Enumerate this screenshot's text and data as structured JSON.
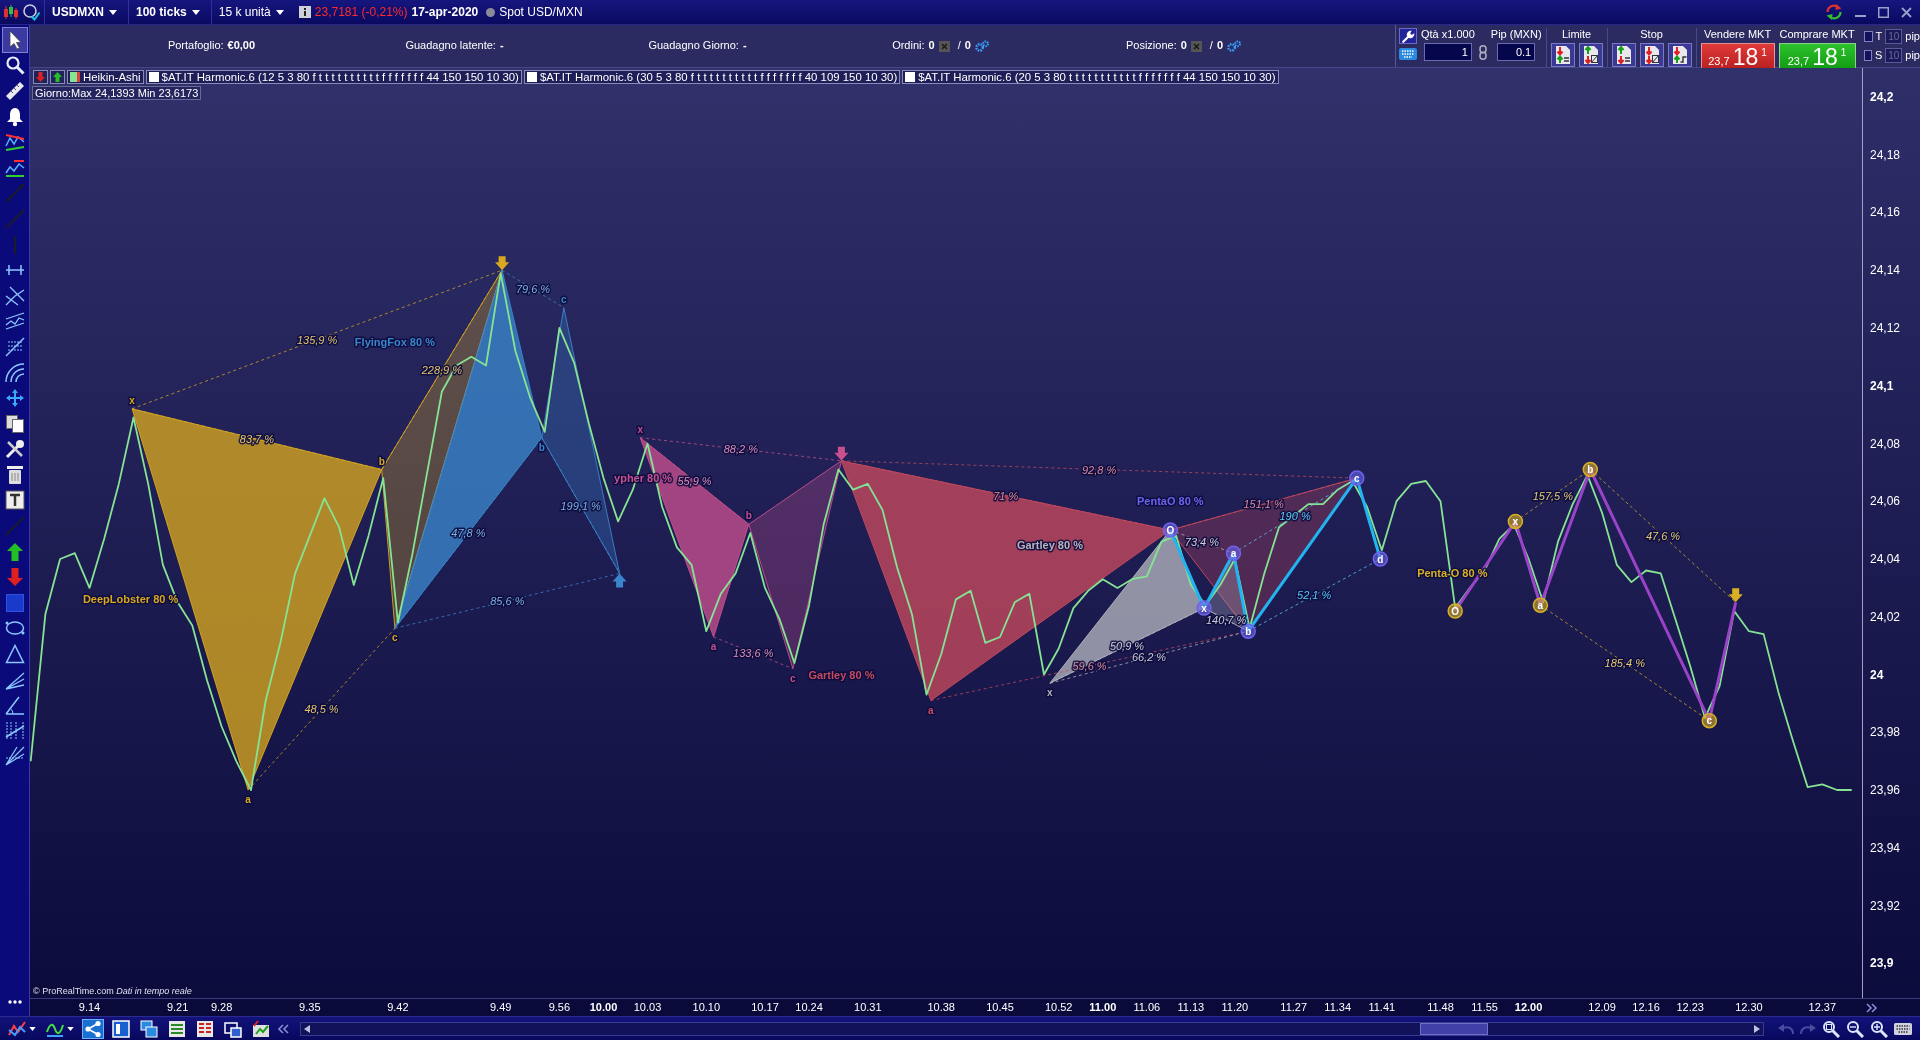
{
  "top_bar": {
    "instrument": "USDMXN",
    "interval": "100 ticks",
    "units": "15 k unità",
    "last_price": "23,7181 (-0,21%)",
    "date": "17-apr-2020",
    "market": "Spot USD/MXN"
  },
  "account": [
    {
      "label": "Portafoglio:",
      "value": "€0,00"
    },
    {
      "label": "Guadagno latente:",
      "value": "-"
    },
    {
      "label": "Guadagno Giorno:",
      "value": "-"
    }
  ],
  "counters": [
    {
      "label": "Ordini:",
      "value": "0",
      "divider": "/",
      "value_2": "0"
    },
    {
      "label": "Posizione:",
      "value": "0",
      "divider": "/",
      "value_2": "0"
    }
  ],
  "order_panel": {
    "quantity": {
      "label": "Qtà x1.000",
      "value": "1"
    },
    "pip": {
      "label": "Pip (MXN)",
      "value": "0.1"
    },
    "limit_label": "Limite",
    "stop_label": "Stop",
    "sell": {
      "label": "Vendere MKT",
      "prefix": "23,7",
      "big": "18",
      "pipette": "1"
    },
    "buy": {
      "label": "Comprare MKT",
      "prefix": "23,7",
      "big": "18",
      "pipette": "1"
    }
  },
  "trailing": [
    {
      "label": "T",
      "checked": false,
      "value": "10",
      "unit": "pip",
      "disabled": true
    },
    {
      "label": "S",
      "checked": false,
      "value": "10",
      "unit": "pip",
      "disabled": true
    }
  ],
  "tools": [
    {
      "kind": "cursor",
      "selected": true
    },
    {
      "kind": "zoom",
      "selected": false
    },
    {
      "kind": "ruler",
      "selected": false
    },
    {
      "kind": "alert",
      "selected": false
    },
    {
      "kind": "zigzag",
      "selected": false
    },
    {
      "kind": "wave",
      "selected": false
    },
    {
      "kind": "segment",
      "selected": false
    },
    {
      "kind": "line",
      "selected": false
    },
    {
      "kind": "vline",
      "selected": false
    },
    {
      "kind": "hline",
      "selected": false
    },
    {
      "kind": "pitchfork",
      "selected": false
    },
    {
      "kind": "channel",
      "selected": false
    },
    {
      "kind": "fibonacci",
      "selected": false
    },
    {
      "kind": "arcs",
      "selected": false
    },
    {
      "kind": "move",
      "selected": false
    },
    {
      "kind": "copy",
      "selected": false
    },
    {
      "kind": "tools",
      "selected": false
    },
    {
      "kind": "trash",
      "selected": false
    },
    {
      "kind": "text",
      "selected": false
    },
    {
      "kind": "ray",
      "selected": false
    },
    {
      "kind": "buy",
      "selected": false
    },
    {
      "kind": "sell",
      "selected": false
    },
    {
      "kind": "rectangle",
      "selected": false
    },
    {
      "kind": "ellipse",
      "selected": false
    },
    {
      "kind": "triangle",
      "selected": false
    },
    {
      "kind": "fan",
      "selected": false
    },
    {
      "kind": "angle",
      "selected": false
    },
    {
      "kind": "timezones",
      "selected": false
    },
    {
      "kind": "gann",
      "selected": false
    }
  ],
  "chart": {
    "legend": [
      {
        "label": "$AT.IT Harmonic.6 (12 5 3 80 f t t t t t t t t t t f f f f f f f 44 150 150 10 30)"
      },
      {
        "label": "$AT.IT Harmonic.6 (30 5 3 80 f t t t t t t t t t t f f f f f f f 40 109 150 10 30)"
      },
      {
        "label": "$AT.IT Harmonic.6 (20 5 3 80 t t t t t t t t t t t f f f f f f f 44 150 150 10 30)"
      }
    ],
    "day_range": "Giorno:Max 24,1393 Min 23,6173",
    "credit": "© ProRealTime.com *Dati in tempo reale*",
    "patterns": [
      {
        "kind": "harmonic",
        "name": "DeepLobster 80 %",
        "color": "#d9a81e",
        "marks": [
          {
            "kind": "letter",
            "label": "x"
          },
          {
            "kind": "letter",
            "label": "a"
          },
          {
            "kind": "letter",
            "label": "b"
          },
          {
            "kind": "letter",
            "label": "c"
          },
          {
            "kind": "down"
          }
        ],
        "ratios": [
          {
            "text": "83,7 %"
          },
          {
            "text": "48,5 %"
          },
          {
            "text": "228,9 %"
          },
          {
            "text": "135,9 %"
          }
        ]
      },
      {
        "kind": "harmonic",
        "name": "FlyingFox 80 %",
        "color": "#3a86cc",
        "marks": [
          {
            "kind": "letter",
            "label": "b"
          },
          {
            "kind": "letter",
            "label": "c"
          },
          {
            "kind": "up"
          }
        ],
        "ratios": [
          {
            "text": "47,8 %"
          },
          {
            "text": "79,6 %"
          },
          {
            "text": "199,1 %"
          },
          {
            "text": "85,6 %"
          }
        ]
      },
      {
        "kind": "harmonic",
        "name": "ypher 80 %",
        "color": "#c8508e",
        "marks": [
          {
            "kind": "letter",
            "label": "x"
          },
          {
            "kind": "letter",
            "label": "a"
          },
          {
            "kind": "letter",
            "label": "b"
          },
          {
            "kind": "letter",
            "label": "c"
          },
          {
            "kind": "down"
          }
        ],
        "ratios": [
          {
            "text": "55,9 %"
          },
          {
            "text": "133,6 %"
          },
          {
            "text": "88,2 %"
          }
        ]
      },
      {
        "kind": "harmonic",
        "name": "Gartley 80 %",
        "color": "#c84a5e",
        "marks": [
          {
            "kind": "letter",
            "label": "a"
          }
        ],
        "ratios": [
          {
            "text": "71 %"
          },
          {
            "text": "59,6 %"
          },
          {
            "text": "151,1 %"
          },
          {
            "text": "92,8 %"
          }
        ]
      },
      {
        "kind": "harmonic",
        "name": "Gartley 80 %",
        "color": "#b4b4be",
        "marks": [
          {
            "kind": "letter",
            "label": "x"
          }
        ],
        "ratios": [
          {
            "text": "50,9 %"
          },
          {
            "text": "73,4 %"
          },
          {
            "text": "140,7 %"
          },
          {
            "text": "66,2 %"
          }
        ]
      },
      {
        "kind": "penta",
        "name": "PentaO 80 %",
        "color": "#6c64ee",
        "zigzag": {
          "color": "#22b4f0"
        },
        "marks": [
          {
            "kind": "circle",
            "label": "O"
          },
          {
            "kind": "circle",
            "label": "x"
          },
          {
            "kind": "circle",
            "label": "a"
          },
          {
            "kind": "circle",
            "label": "b"
          },
          {
            "kind": "circle",
            "label": "c"
          },
          {
            "kind": "circle",
            "label": "d"
          }
        ],
        "ratios": [
          {
            "text": "190 %",
            "color": "#5cc8f0"
          },
          {
            "text": "52,1 %",
            "color": "#5cc8f0"
          }
        ]
      },
      {
        "kind": "penta",
        "name": "Penta-O 80 %",
        "color": "#d9b024",
        "zigzag": {
          "color": "#9a42c8"
        },
        "marks": [
          {
            "kind": "circle",
            "label": "O"
          },
          {
            "kind": "circle",
            "label": "x"
          },
          {
            "kind": "circle",
            "label": "a"
          },
          {
            "kind": "circle",
            "label": "b"
          },
          {
            "kind": "circle",
            "label": "c"
          },
          {
            "kind": "down"
          }
        ],
        "ratios": [
          {
            "text": "157,5 %"
          },
          {
            "text": "47,6 %"
          },
          {
            "text": "185,4 %"
          }
        ]
      }
    ],
    "chart_data": {
      "type": "line",
      "categories": [
        null,
        null,
        null,
        null,
        "9.14",
        null,
        null,
        null,
        null,
        null,
        "9.21",
        null,
        null,
        "9.28",
        null,
        null,
        null,
        null,
        null,
        "9.35",
        null,
        null,
        null,
        null,
        null,
        "9.42",
        null,
        null,
        null,
        null,
        null,
        null,
        "9.49",
        null,
        null,
        null,
        "9.56",
        null,
        null,
        "10.00",
        null,
        null,
        "10.03",
        null,
        null,
        null,
        "10.10",
        null,
        null,
        null,
        "10.17",
        null,
        null,
        "10.24",
        null,
        null,
        null,
        "10.31",
        null,
        null,
        null,
        null,
        "10.38",
        null,
        null,
        null,
        "10.45",
        null,
        null,
        null,
        "10.52",
        null,
        null,
        "11.00",
        null,
        null,
        "11.06",
        null,
        null,
        "11.13",
        null,
        null,
        "11.20",
        null,
        null,
        null,
        "11.27",
        null,
        null,
        "11.34",
        null,
        null,
        "11.41",
        null,
        null,
        null,
        "11.48",
        null,
        null,
        "11.55",
        null,
        null,
        "12.00",
        null,
        null,
        null,
        null,
        "12.09",
        null,
        null,
        "12.16",
        null,
        null,
        "12.23",
        null,
        null,
        null,
        "12.30",
        null,
        null,
        null,
        null,
        "12.37",
        null,
        null
      ],
      "series": [
        {
          "name": "Heikin-Ashi",
          "color": "#86e394",
          "values": [
            23.97,
            24.021,
            24.04,
            24.042,
            24.03,
            24.047,
            24.066,
            24.089,
            24.066,
            24.038,
            24.025,
            24.017,
            23.998,
            23.982,
            23.97,
            23.96,
            23.991,
            24.011,
            24.035,
            24.048,
            24.061,
            24.051,
            24.031,
            24.048,
            24.068,
            24.018,
            24.042,
            24.07,
            24.098,
            24.107,
            24.11,
            24.107,
            24.139,
            24.112,
            24.096,
            24.084,
            24.12,
            24.108,
            24.087,
            24.068,
            24.053,
            24.064,
            24.08,
            24.058,
            24.044,
            24.038,
            24.015,
            24.028,
            24.035,
            24.049,
            24.03,
            24.019,
            24.004,
            24.024,
            24.052,
            24.071,
            24.064,
            24.066,
            24.057,
            24.037,
            24.021,
            23.993,
            24.007,
            24.026,
            24.029,
            24.011,
            24.013,
            24.025,
            24.028,
            24.0,
            24.009,
            24.023,
            24.029,
            24.033,
            24.03,
            24.033,
            24.034,
            24.046,
            24.048,
            24.031,
            24.024,
            24.031,
            24.04,
            24.016,
            24.035,
            24.051,
            24.055,
            24.059,
            24.059,
            24.064,
            24.067,
            24.058,
            24.043,
            24.06,
            24.066,
            24.067,
            24.06,
            24.023,
            24.03,
            24.036,
            24.047,
            24.052,
            24.04,
            24.025,
            24.046,
            24.059,
            24.069,
            24.056,
            24.038,
            24.032,
            24.036,
            24.035,
            24.019,
            24.003,
            23.985,
            23.996,
            24.022,
            24.015,
            24.014,
            23.994,
            23.977,
            23.961,
            23.962,
            23.96,
            23.96
          ]
        }
      ],
      "ylim": [
        23.888,
        24.21
      ],
      "yticks": [
        {
          "value": 24.2,
          "label": "24,2"
        },
        {
          "value": 24.18,
          "label": "24,18"
        },
        {
          "value": 24.16,
          "label": "24,16"
        },
        {
          "value": 24.14,
          "label": "24,14"
        },
        {
          "value": 24.12,
          "label": "24,12"
        },
        {
          "value": 24.1,
          "label": "24,1"
        },
        {
          "value": 24.08,
          "label": "24,08"
        },
        {
          "value": 24.06,
          "label": "24,06"
        },
        {
          "value": 24.04,
          "label": "24,04"
        },
        {
          "value": 24.02,
          "label": "24,02"
        },
        {
          "value": 24,
          "label": "24"
        },
        {
          "value": 23.98,
          "label": "23,98"
        },
        {
          "value": 23.96,
          "label": "23,96"
        },
        {
          "value": 23.94,
          "label": "23,94"
        },
        {
          "value": 23.92,
          "label": "23,92"
        },
        {
          "value": 23.9,
          "label": "23,9"
        }
      ]
    }
  },
  "bottom_tools": [
    {
      "kind": "linechart",
      "menu": true,
      "selected": false
    },
    {
      "kind": "wave",
      "menu": true,
      "selected": false
    },
    {
      "kind": "share",
      "menu": false,
      "selected": true
    },
    {
      "kind": "panel",
      "menu": false,
      "selected": false
    },
    {
      "kind": "windows",
      "menu": false,
      "selected": false
    },
    {
      "kind": "list",
      "menu": false,
      "selected": false
    },
    {
      "kind": "table",
      "menu": false,
      "selected": false
    },
    {
      "kind": "monitors",
      "menu": false,
      "selected": false
    },
    {
      "kind": "report",
      "menu": false,
      "selected": false
    }
  ],
  "history": [
    {
      "kind": "undo",
      "disabled": true
    },
    {
      "kind": "redo",
      "disabled": true
    }
  ]
}
